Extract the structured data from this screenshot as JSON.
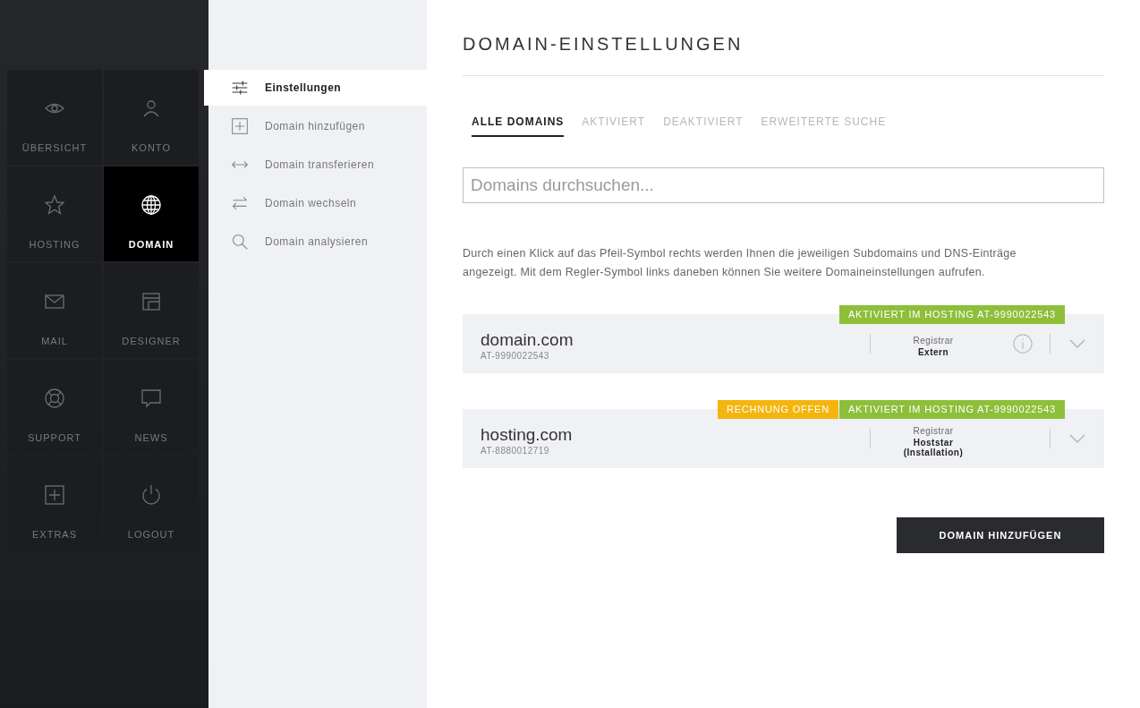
{
  "nav_tiles": [
    {
      "kind": "eye",
      "label": "ÜBERSICHT",
      "selected": false
    },
    {
      "kind": "person",
      "label": "KONTO",
      "selected": false
    },
    {
      "kind": "star",
      "label": "HOSTING",
      "selected": false
    },
    {
      "kind": "globe",
      "label": "DOMAIN",
      "selected": true
    },
    {
      "kind": "mail",
      "label": "MAIL",
      "selected": false
    },
    {
      "kind": "layout",
      "label": "DESIGNER",
      "selected": false
    },
    {
      "kind": "lifebuoy",
      "label": "SUPPORT",
      "selected": false
    },
    {
      "kind": "chat",
      "label": "NEWS",
      "selected": false
    },
    {
      "kind": "plusbox",
      "label": "EXTRAS",
      "selected": false
    },
    {
      "kind": "power",
      "label": "LOGOUT",
      "selected": false
    }
  ],
  "submenu": [
    {
      "kind": "sliders",
      "label": "Einstellungen",
      "selected": true
    },
    {
      "kind": "plusbox",
      "label": "Domain hinzufügen",
      "selected": false
    },
    {
      "kind": "leftright",
      "label": "Domain transferieren",
      "selected": false
    },
    {
      "kind": "swap",
      "label": "Domain wechseln",
      "selected": false
    },
    {
      "kind": "search",
      "label": "Domain analysieren",
      "selected": false
    }
  ],
  "page_title": "DOMAIN-EINSTELLUNGEN",
  "tabs": [
    {
      "label": "ALLE DOMAINS",
      "selected": true
    },
    {
      "label": "AKTIVIERT",
      "selected": false
    },
    {
      "label": "DEAKTIVIERT",
      "selected": false
    },
    {
      "label": "ERWEITERTE SUCHE",
      "selected": false
    }
  ],
  "search": {
    "placeholder": "Domains durchsuchen..."
  },
  "hint": "Durch einen Klick auf das Pfeil-Symbol rechts werden Ihnen die jeweiligen Subdomains und DNS-Einträge angezeigt. Mit dem Regler-Symbol links daneben können Sie weitere Domaineinstellungen aufrufen.",
  "domains": [
    {
      "name": "domain.com",
      "id": "AT-9990022543",
      "badges": [
        {
          "text": "AKTIVIERT IM HOSTING AT-9990022543",
          "color": "#8dbf3a"
        }
      ],
      "registrar_label": "Registrar",
      "registrar": [
        "Extern"
      ],
      "info": true
    },
    {
      "name": "hosting.com",
      "id": "AT-8880012719",
      "badges": [
        {
          "text": "RECHNUNG OFFEN",
          "color": "#f5b50f"
        },
        {
          "text": "AKTIVIERT IM HOSTING AT-9990022543",
          "color": "#8dbf3a"
        }
      ],
      "registrar_label": "Registrar",
      "registrar": [
        "Hoststar",
        "(Installation)"
      ],
      "info": false
    }
  ],
  "add_button": "DOMAIN HINZUFÜGEN"
}
